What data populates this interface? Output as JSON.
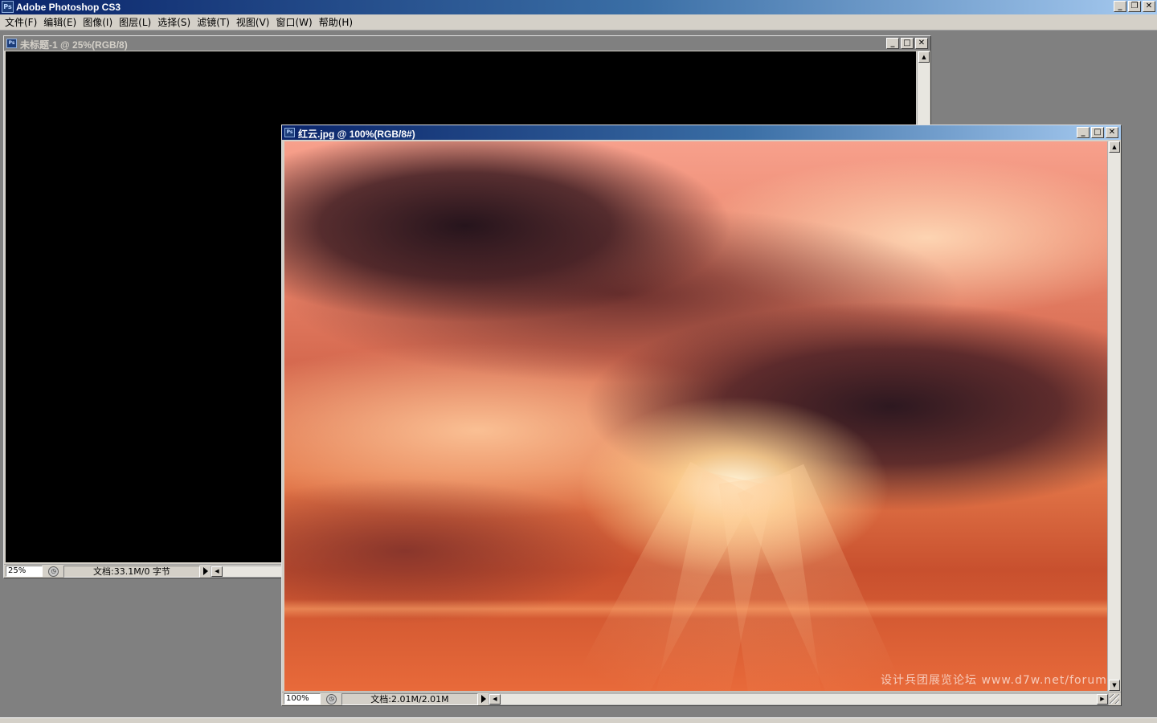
{
  "app": {
    "title": "Adobe Photoshop CS3",
    "logo": "Ps",
    "window_buttons": {
      "minimize": "_",
      "restore": "❐",
      "close": "✕"
    }
  },
  "menu": {
    "items": [
      {
        "label": "文件(F)"
      },
      {
        "label": "编辑(E)"
      },
      {
        "label": "图像(I)"
      },
      {
        "label": "图层(L)"
      },
      {
        "label": "选择(S)"
      },
      {
        "label": "滤镜(T)"
      },
      {
        "label": "视图(V)"
      },
      {
        "label": "窗口(W)"
      },
      {
        "label": "帮助(H)"
      }
    ]
  },
  "doc_untitled": {
    "title": "未标题-1 @ 25%(RGB/8)",
    "zoom": "25%",
    "doc_info": "文档:33.1M/0 字节",
    "canvas_color": "#000000"
  },
  "doc_photo": {
    "title": "红云.jpg @ 100%(RGB/8#)",
    "zoom": "100%",
    "doc_info": "文档:2.01M/2.01M"
  },
  "watermark": "设计兵团展览论坛 www.d7w.net/forum",
  "colors": {
    "titlebar_active": "#0a246a",
    "titlebar_inactive": "#808080",
    "chrome": "#d4d0c8",
    "workspace": "#808080"
  }
}
